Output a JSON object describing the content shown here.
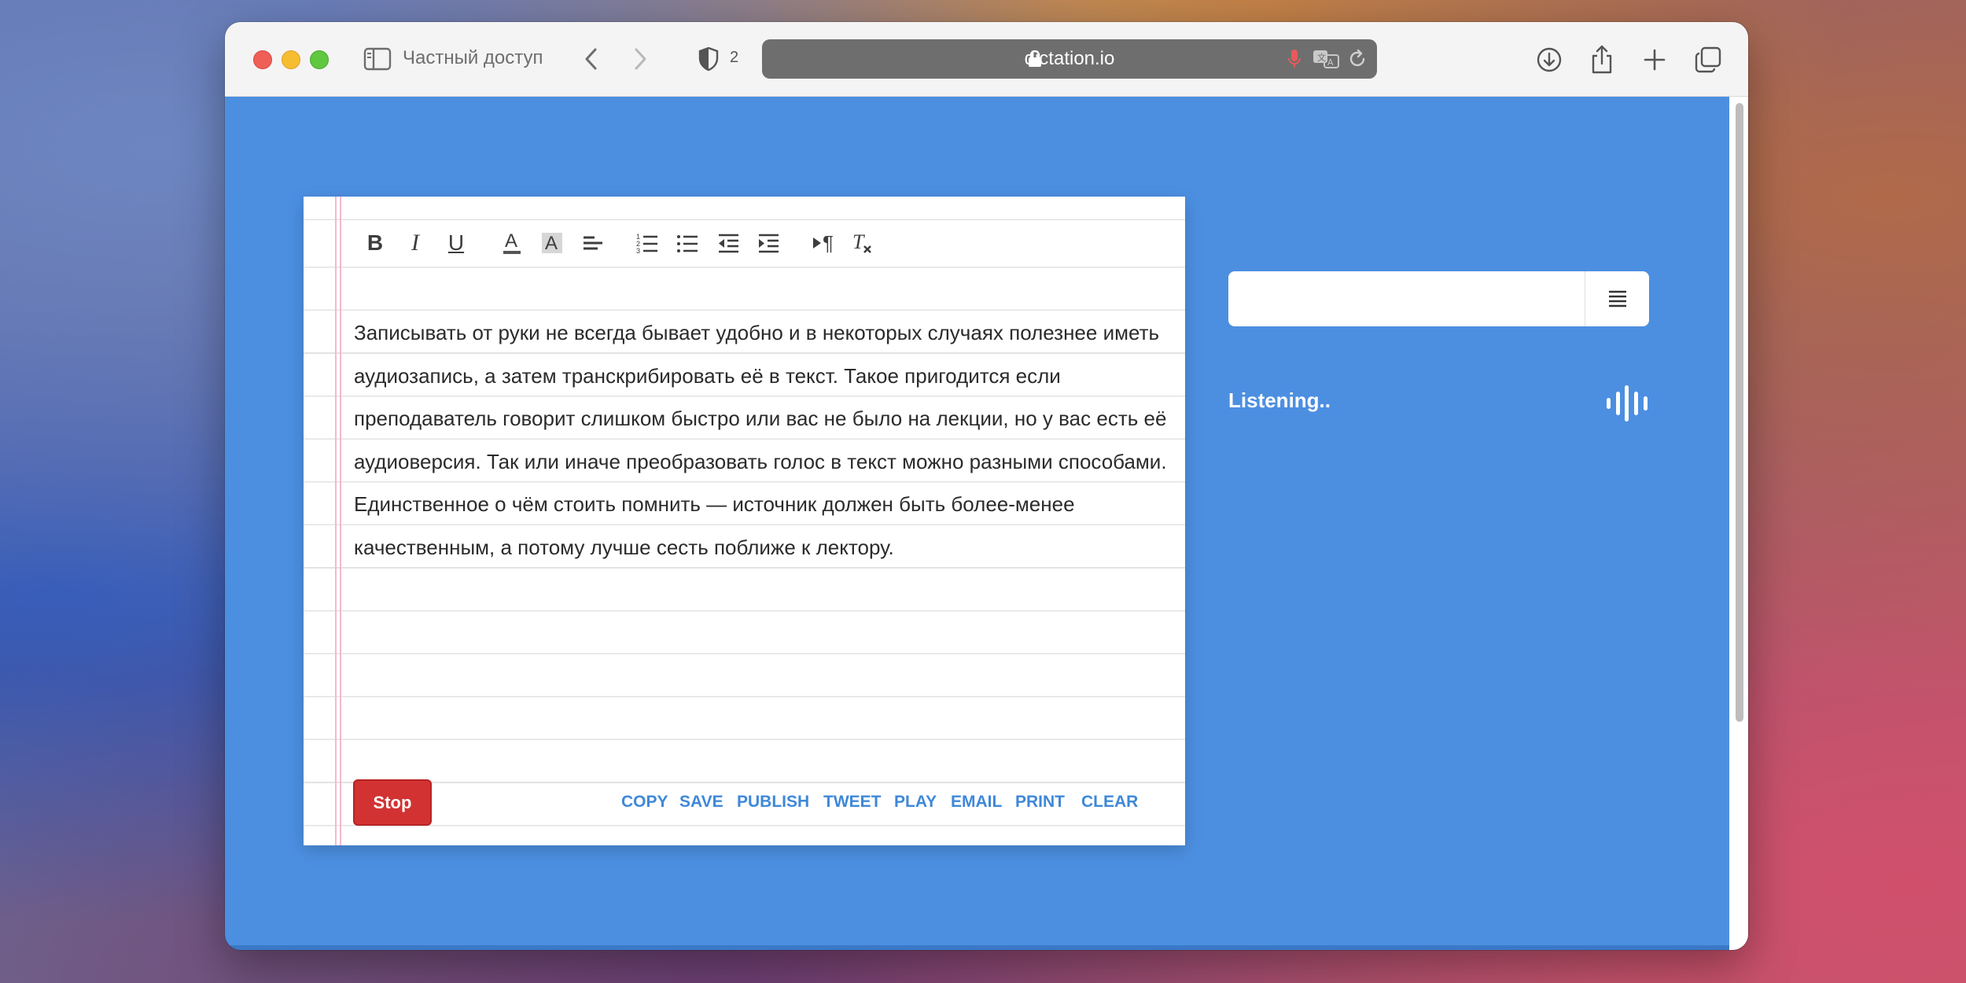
{
  "browser": {
    "private_label": "Частный доступ",
    "tracker_count": "2",
    "url": "dictation.io",
    "icons": [
      "sidebar-icon",
      "chevron-left-icon",
      "chevron-right-icon",
      "shield-icon",
      "lock-icon",
      "microphone-icon",
      "translate-icon",
      "reload-icon",
      "download-icon",
      "share-icon",
      "plus-icon",
      "tabs-icon"
    ]
  },
  "editor": {
    "toolbar": {
      "bold": "B",
      "italic": "I",
      "underline": "U",
      "text_color": "A",
      "highlight": "A",
      "paragraph": "¶",
      "clear_format": "T"
    },
    "content": "Записывать от руки не всегда бывает удобно и в некоторых случаях полезнее иметь\nаудиозапись, а затем транскрибировать её в текст. Такое пригодится если\nпреподаватель говорит слишком быстро или вас не было на лекции, но у вас есть её\nаудиоверсия. Так или иначе преобразовать голос в текст можно разными способами.\nЕдинственное о чём стоить помнить — источник должен быть более-менее\nкачественным, а потому лучше сесть поближе к лектору.",
    "stop_label": "Stop",
    "actions": [
      "COPY",
      "SAVE",
      "PUBLISH",
      "TWEET",
      "PLAY",
      "EMAIL",
      "PRINT",
      "CLEAR"
    ]
  },
  "panel": {
    "language_value": "",
    "status": "Listening.."
  },
  "colors": {
    "page_bg": "#4c8fe1",
    "stop": "#d23232",
    "action_link": "#3f88d8",
    "margin_line": "#f3b9cd"
  }
}
